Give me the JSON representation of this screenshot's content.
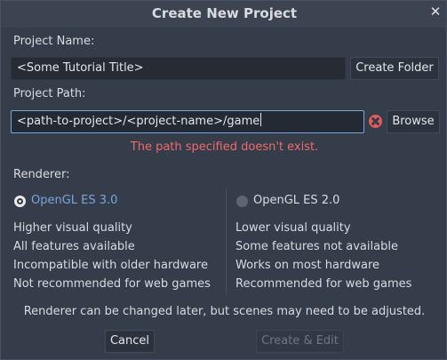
{
  "dialog": {
    "title": "Create New Project",
    "close_glyph": "✕"
  },
  "project_name": {
    "label": "Project Name:",
    "value": "<Some Tutorial Title>",
    "create_folder_label": "Create Folder"
  },
  "project_path": {
    "label": "Project Path:",
    "value": "<path-to-project>/<project-name>/game",
    "browse_label": "Browse",
    "error_icon": "error-icon",
    "error_color": "#ee6b6b",
    "error_message": "The path specified doesn't exist."
  },
  "renderer": {
    "label": "Renderer:",
    "options": [
      {
        "label": "OpenGL ES 3.0",
        "selected": true,
        "features": [
          "Higher visual quality",
          "All features available",
          "Incompatible with older hardware",
          "Not recommended for web games"
        ]
      },
      {
        "label": "OpenGL ES 2.0",
        "selected": false,
        "features": [
          "Lower visual quality",
          "Some features not available",
          "Works on most hardware",
          "Recommended for web games"
        ]
      }
    ],
    "note": "Renderer can be changed later, but scenes may need to be adjusted."
  },
  "actions": {
    "cancel_label": "Cancel",
    "create_label": "Create & Edit",
    "create_enabled": false
  },
  "colors": {
    "accent": "#7aa3dd",
    "error": "#e55a5a",
    "background": "#363d4a"
  }
}
